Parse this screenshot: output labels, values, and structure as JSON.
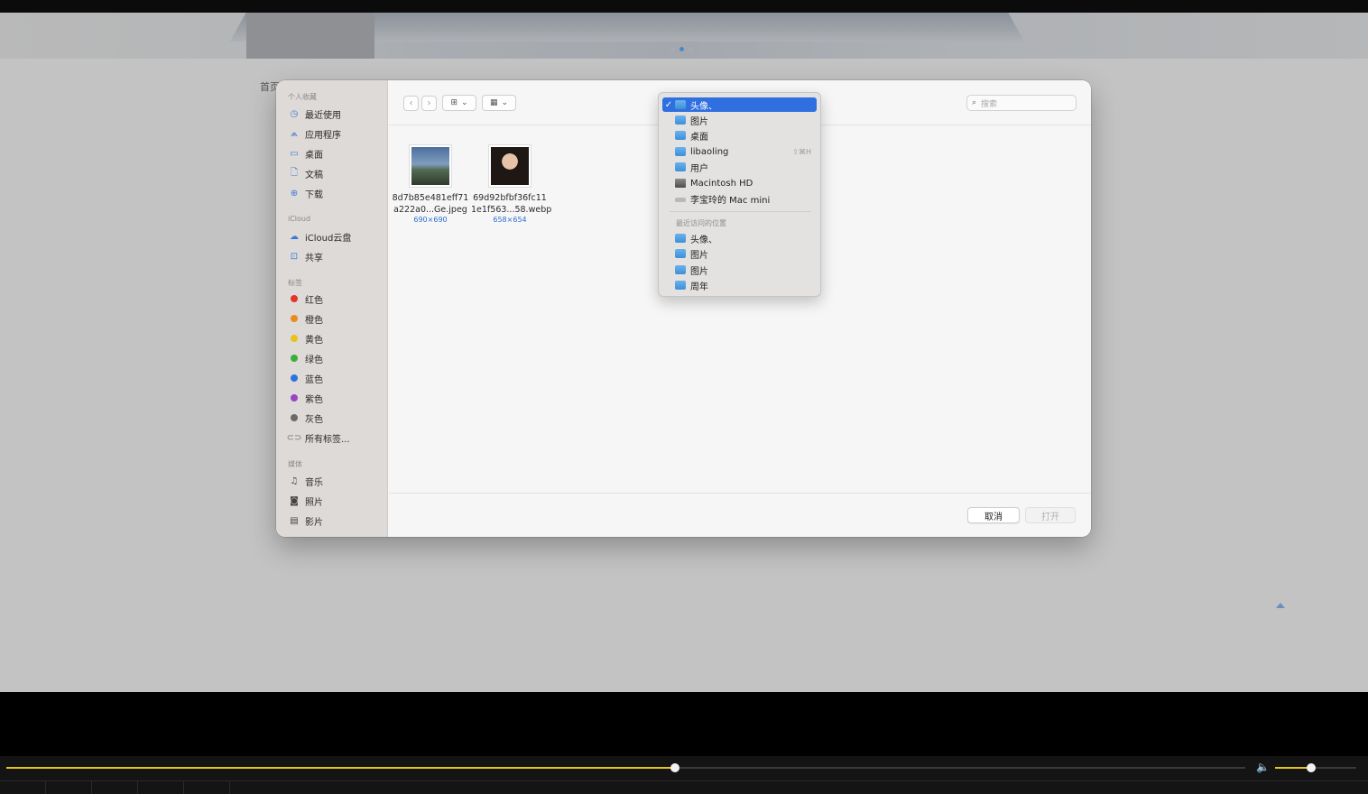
{
  "page": {
    "breadcrumb": "首页"
  },
  "sidebar": {
    "favorites_label": "个人收藏",
    "favorites": [
      {
        "label": "最近使用",
        "icon": "clock-icon"
      },
      {
        "label": "应用程序",
        "icon": "apps-icon"
      },
      {
        "label": "桌面",
        "icon": "desktop-icon"
      },
      {
        "label": "文稿",
        "icon": "document-icon"
      },
      {
        "label": "下载",
        "icon": "download-icon"
      }
    ],
    "icloud_label": "iCloud",
    "icloud": [
      {
        "label": "iCloud云盘",
        "icon": "cloud-icon"
      },
      {
        "label": "共享",
        "icon": "shared-folder-icon"
      }
    ],
    "tags_label": "标签",
    "tags": [
      {
        "label": "红色",
        "color": "#e5332a"
      },
      {
        "label": "橙色",
        "color": "#ec8a1e"
      },
      {
        "label": "黄色",
        "color": "#e9c21a"
      },
      {
        "label": "绿色",
        "color": "#36b03b"
      },
      {
        "label": "蓝色",
        "color": "#2c73e2"
      },
      {
        "label": "紫色",
        "color": "#9a45c4"
      },
      {
        "label": "灰色",
        "color": "#6a6a6a"
      },
      {
        "label": "所有标签...",
        "color": ""
      }
    ],
    "media_label": "媒体",
    "media": [
      {
        "label": "音乐",
        "icon": "music-icon"
      },
      {
        "label": "照片",
        "icon": "camera-icon"
      },
      {
        "label": "影片",
        "icon": "film-icon"
      }
    ]
  },
  "toolbar": {
    "search_placeholder": "搜索"
  },
  "files": [
    {
      "name_line1": "8d7b85e481eff71",
      "name_line2": "a222a0...Ge.jpeg",
      "dims": "690×690"
    },
    {
      "name_line1": "69d92bfbf36fc11",
      "name_line2": "1e1f563...58.webp",
      "dims": "658×654"
    }
  ],
  "location_menu": {
    "items": [
      {
        "label": "头像、",
        "icon": "folder-icon",
        "selected": true
      },
      {
        "label": "图片",
        "icon": "folder-icon"
      },
      {
        "label": "桌面",
        "icon": "folder-icon"
      },
      {
        "label": "libaoling",
        "icon": "home-folder-icon",
        "shortcut": "⇧⌘H"
      },
      {
        "label": "用户",
        "icon": "folder-icon"
      },
      {
        "label": "Macintosh HD",
        "icon": "hard-drive-icon"
      },
      {
        "label": "李宝玲的 Mac mini",
        "icon": "mac-mini-icon"
      }
    ],
    "recent_header": "最近访问的位置",
    "recent": [
      {
        "label": "头像、",
        "icon": "folder-icon"
      },
      {
        "label": "图片",
        "icon": "folder-icon"
      },
      {
        "label": "图片",
        "icon": "folder-icon"
      },
      {
        "label": "周年",
        "icon": "folder-icon"
      }
    ]
  },
  "buttons": {
    "cancel": "取消",
    "open": "打开"
  },
  "player": {
    "progress": 0.54,
    "volume": 0.44,
    "accent": "#e8c31d"
  }
}
